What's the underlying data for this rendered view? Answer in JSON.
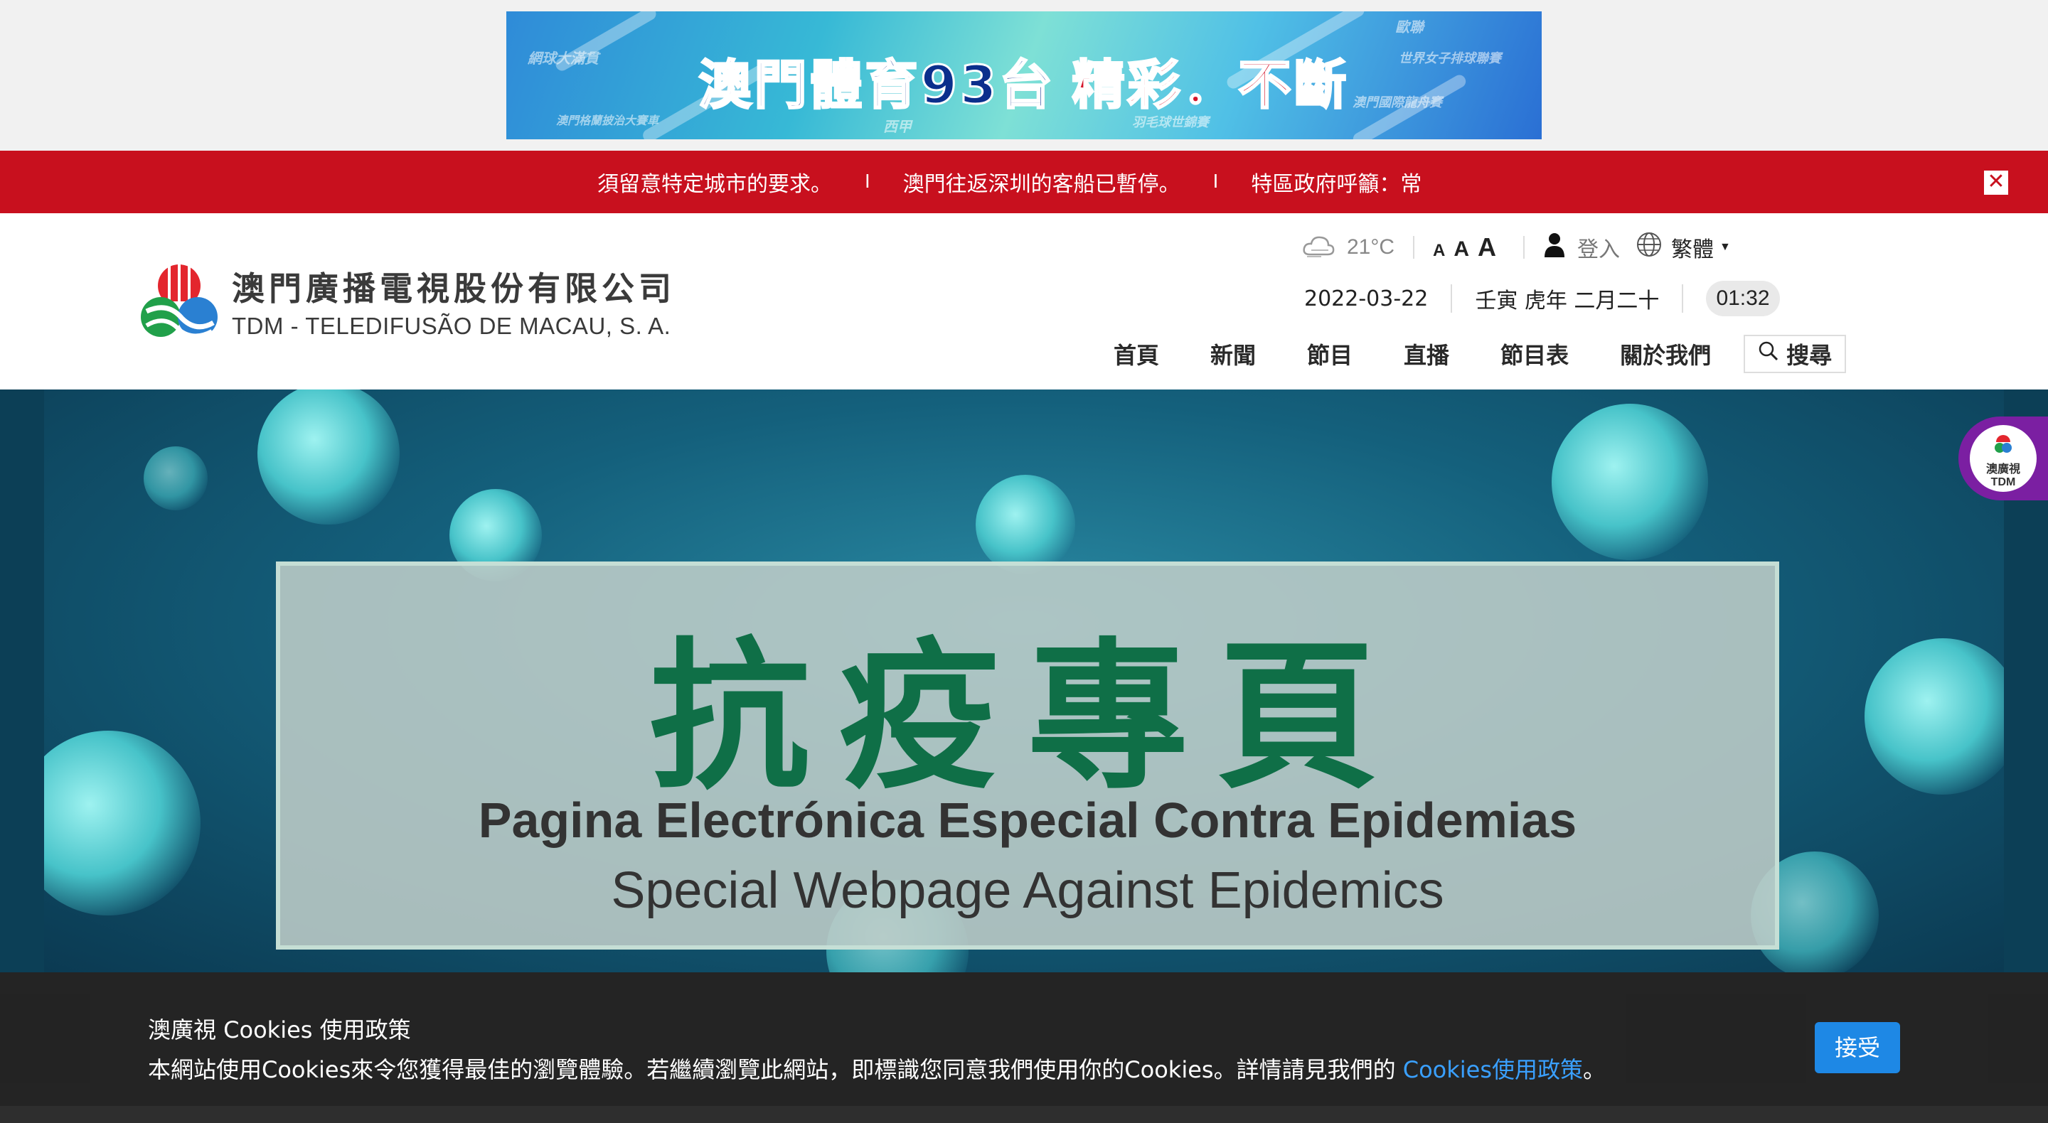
{
  "promo": {
    "title_blue": "澳門體育93台",
    "title_red": "精彩．不斷",
    "ghost_texts": [
      "網球大滿貫",
      "澳門格蘭披治大賽車",
      "西甲",
      "歐聯",
      "世界女子排球聯賽",
      "澳門國際龍舟賽",
      "羽毛球世錦賽"
    ]
  },
  "ticker": {
    "items": [
      "須留意特定城市的要求。",
      "澳門往返深圳的客船已暫停。",
      "特區政府呼籲：常"
    ],
    "separator": "I",
    "close_symbol": "✕"
  },
  "logo": {
    "name_cn": "澳門廣播電視股份有限公司",
    "name_pt": "TDM - TELEDIFUSÃO DE MACAU, S. A."
  },
  "utility": {
    "temperature": "21°C",
    "font_sizes": [
      "A",
      "A",
      "A"
    ],
    "login_label": "登入",
    "language": "繁體"
  },
  "dateline": {
    "date": "2022-03-22",
    "lunar": "壬寅 虎年 二月二十",
    "time": "01:32"
  },
  "nav": {
    "items": [
      "首頁",
      "新聞",
      "節目",
      "直播",
      "節目表",
      "關於我們"
    ],
    "search_label": "搜尋"
  },
  "hero": {
    "title_cn": "抗疫專頁",
    "title_pt": "Pagina Electrónica Especial Contra Epidemias",
    "title_en": "Special Webpage Against Epidemics"
  },
  "side_badge": {
    "line1": "澳廣視",
    "line2": "TDM"
  },
  "cookie": {
    "title": "澳廣視 Cookies 使用政策",
    "body": "本網站使用Cookies來令您獲得最佳的瀏覽體驗。若繼續瀏覽此網站，即標識您同意我們使用你的Cookies。詳情請見我們的 ",
    "link_text": "Cookies使用政策",
    "tail": "。",
    "accept_label": "接受"
  },
  "colors": {
    "ticker_bg": "#c8101e",
    "hero_title_green": "#0f6f47",
    "accept_blue": "#1e88e5",
    "link_blue": "#3aa0ff",
    "badge_purple": "#7b1fa2"
  }
}
